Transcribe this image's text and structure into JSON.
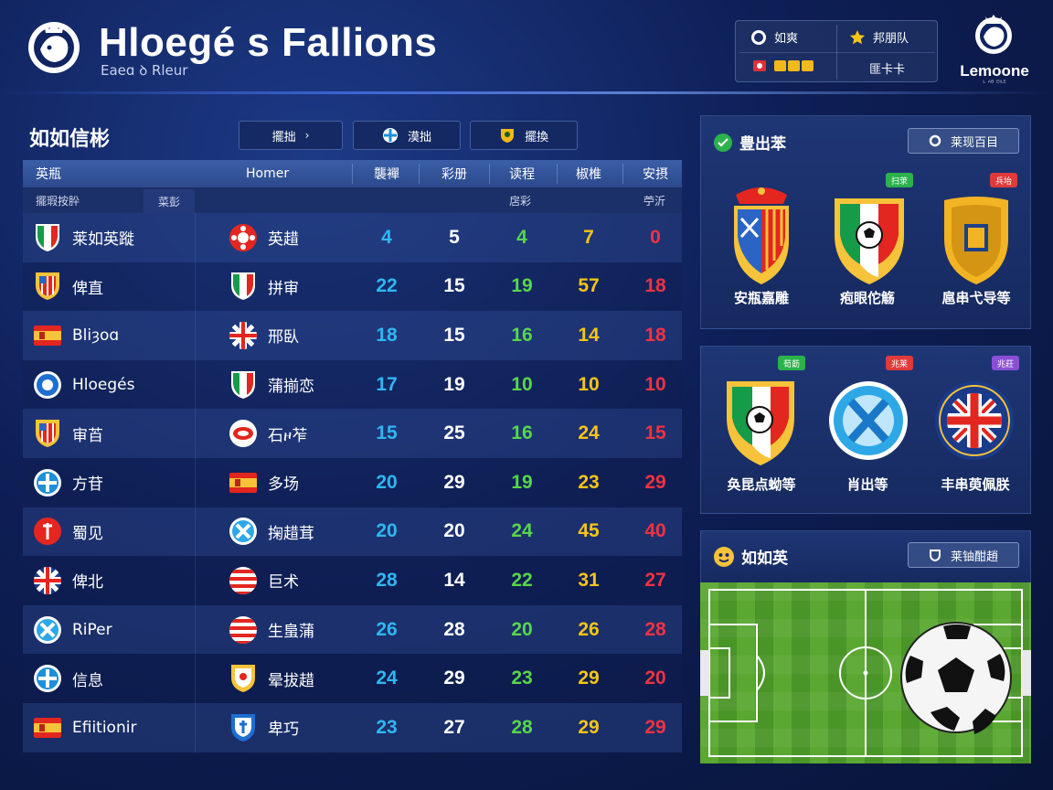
{
  "app": {
    "title": "Hloegé s Fallions",
    "subtitle": "Eaeɑ ꝺ Rleur"
  },
  "top_right": {
    "cells": [
      "如爽",
      "邦朋队",
      "",
      "匪卡卡"
    ],
    "league_name": "Lemoone",
    "league_sub": "ᴸ ᴬᴮ ᴱᴵᴸᴱ"
  },
  "standings": {
    "title": "如如信彬",
    "filters": [
      "擺拙",
      "漠拙",
      "擺換"
    ],
    "columns": [
      "英瓶",
      "Homer",
      "襲襌",
      "彩册",
      "读程",
      "椒椎",
      "安摂"
    ],
    "subheader": {
      "left": "擺瑕按肸",
      "tab": "菜彭",
      "c5": "扂彩",
      "c7": "苧沂"
    },
    "rows": [
      {
        "home": "莱如英蹝",
        "away": "英趞",
        "v": [
          4,
          5,
          4,
          7,
          0
        ],
        "hb": "italy",
        "ab": "roundRed"
      },
      {
        "home": "俾直",
        "away": "拼审",
        "v": [
          22,
          15,
          19,
          57,
          18
        ],
        "hb": "atletico",
        "ab": "italy"
      },
      {
        "home": "Bliȝoɑ",
        "away": "邢臥",
        "v": [
          18,
          15,
          16,
          14,
          18
        ],
        "hb": "spain",
        "ab": "uk"
      },
      {
        "home": "Hloegés",
        "away": "蒲揃恋",
        "v": [
          17,
          19,
          10,
          10,
          10
        ],
        "hb": "blueCircle",
        "ab": "italy"
      },
      {
        "home": "审苩",
        "away": "石ዞ苲",
        "v": [
          15,
          25,
          16,
          24,
          15
        ],
        "hb": "atletico",
        "ab": "redWhite"
      },
      {
        "home": "方苷",
        "away": "多场",
        "v": [
          20,
          29,
          19,
          23,
          29
        ],
        "hb": "blueCross",
        "ab": "spain"
      },
      {
        "home": "蜀见",
        "away": "掬趞茸",
        "v": [
          20,
          20,
          24,
          45,
          40
        ],
        "hb": "redCircle",
        "ab": "blueX"
      },
      {
        "home": "俾北",
        "away": "巨术",
        "v": [
          28,
          14,
          22,
          31,
          27
        ],
        "hb": "uk",
        "ab": "stripes"
      },
      {
        "home": "RiPer",
        "away": "生蛗蒲",
        "v": [
          26,
          28,
          20,
          26,
          28
        ],
        "hb": "blueX",
        "ab": "stripes"
      },
      {
        "home": "信息",
        "away": "晕拔趞",
        "v": [
          24,
          29,
          23,
          29,
          20
        ],
        "hb": "blueCross",
        "ab": "goldShield"
      },
      {
        "home": "Efiitionir",
        "away": "卑巧",
        "v": [
          23,
          27,
          28,
          29,
          29
        ],
        "hb": "spain",
        "ab": "blueShield"
      }
    ],
    "col_colors": [
      "#2fb7f2",
      "#ffffff",
      "#58d64a",
      "#f5c518",
      "#ef3340"
    ]
  },
  "panel_top": {
    "title": "豊出苯",
    "button": "莱现百目",
    "crests": [
      {
        "label": "安瓶嘉雕",
        "tag": "扫莍",
        "tag_color": "#2bb24c"
      },
      {
        "label": "疱眼佗觞",
        "tag": "兵坮",
        "tag_color": "#e03a3a"
      },
      {
        "label": "扈串弋导等",
        "tag": "",
        "tag_color": ""
      }
    ]
  },
  "panel_mid": {
    "crests": [
      {
        "label": "奂昆点蚴等",
        "tag": "荀莇",
        "tag_color": "#2bb24c"
      },
      {
        "label": "肖出等",
        "tag": "兆莱",
        "tag_color": "#e03a3a"
      },
      {
        "label": "丰串萸佩朕",
        "tag": "兆莊",
        "tag_color": "#8a4fd6"
      }
    ]
  },
  "panel_bottom": {
    "title": "如如英",
    "button": "莱铀酣趙"
  },
  "icons": {
    "main_logo": "lion-crest-icon",
    "league_logo": "lion-crest-icon",
    "star": "star-icon",
    "ball": "football-icon"
  }
}
